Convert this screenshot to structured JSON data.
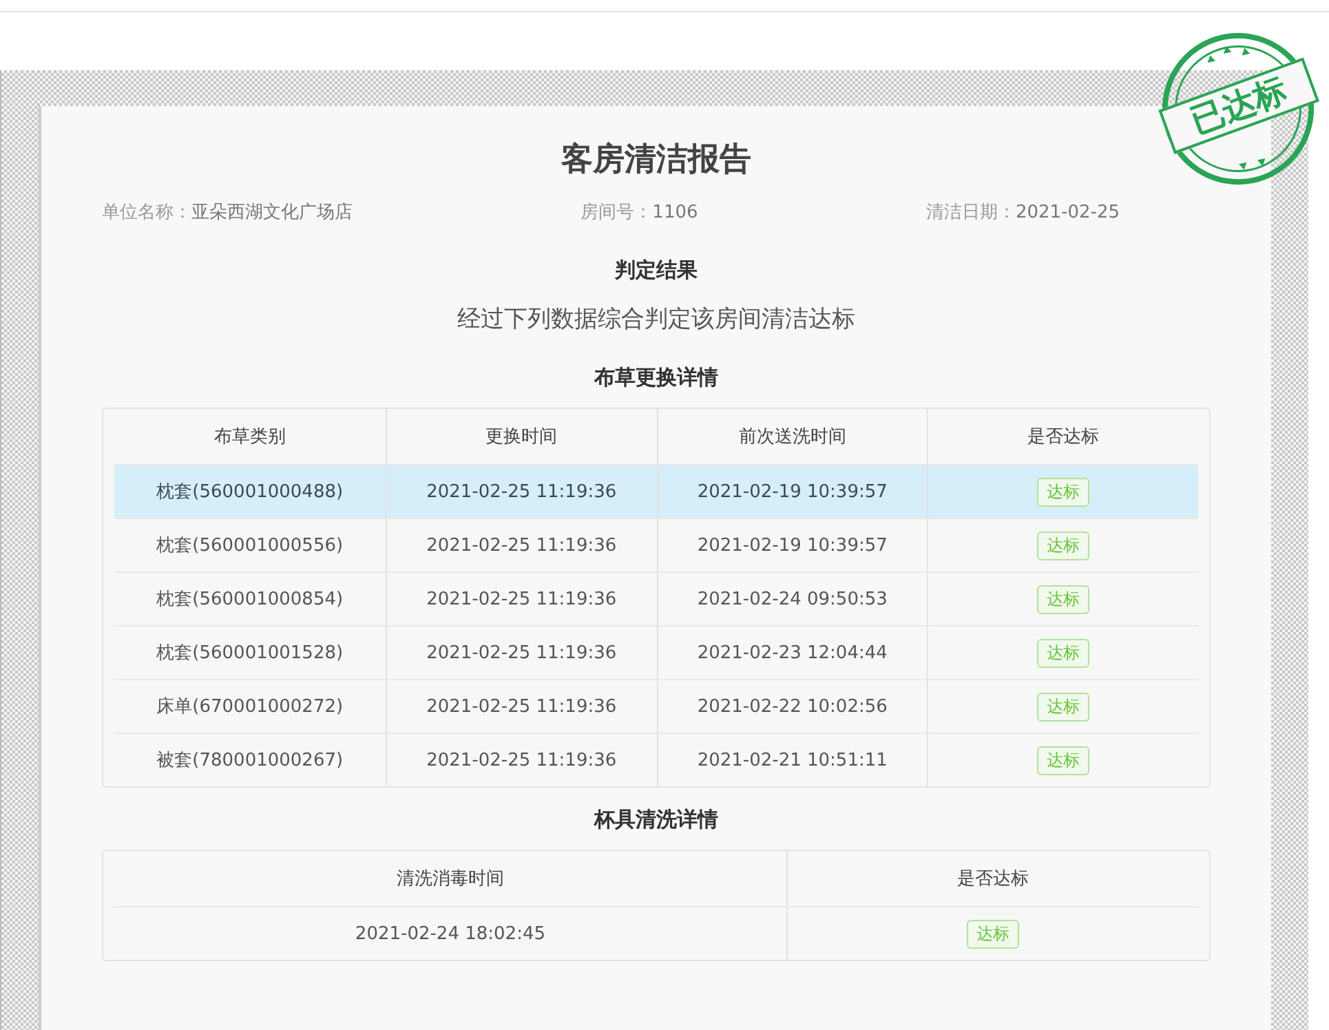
{
  "stamp": {
    "text": "已达标"
  },
  "report": {
    "title": "客房清洁报告",
    "info": [
      {
        "label": "单位名称：",
        "value": "亚朵西湖文化广场店"
      },
      {
        "label": "房间号：",
        "value": "1106"
      },
      {
        "label": "清洁日期：",
        "value": "2021-02-25"
      }
    ],
    "verdict_heading": "判定结果",
    "verdict": "经过下列数据综合判定该房间清洁达标",
    "linen": {
      "heading": "布草更换详情",
      "columns": [
        "布草类别",
        "更换时间",
        "前次送洗时间",
        "是否达标"
      ],
      "rows": [
        {
          "selected": true,
          "cells": [
            "枕套(560001000488)",
            "2021-02-25 11:19:36",
            "2021-02-19 10:39:57"
          ],
          "status": "达标"
        },
        {
          "selected": false,
          "cells": [
            "枕套(560001000556)",
            "2021-02-25 11:19:36",
            "2021-02-19 10:39:57"
          ],
          "status": "达标"
        },
        {
          "selected": false,
          "cells": [
            "枕套(560001000854)",
            "2021-02-25 11:19:36",
            "2021-02-24 09:50:53"
          ],
          "status": "达标"
        },
        {
          "selected": false,
          "cells": [
            "枕套(560001001528)",
            "2021-02-25 11:19:36",
            "2021-02-23 12:04:44"
          ],
          "status": "达标"
        },
        {
          "selected": false,
          "cells": [
            "床单(670001000272)",
            "2021-02-25 11:19:36",
            "2021-02-22 10:02:56"
          ],
          "status": "达标"
        },
        {
          "selected": false,
          "cells": [
            "被套(780001000267)",
            "2021-02-25 11:19:36",
            "2021-02-21 10:51:11"
          ],
          "status": "达标"
        }
      ]
    },
    "cups": {
      "heading": "杯具清洗详情",
      "columns": [
        "清洗消毒时间",
        "是否达标"
      ],
      "rows": [
        {
          "selected": false,
          "cells": [
            "2021-02-24 18:02:45"
          ],
          "status": "达标"
        }
      ]
    }
  }
}
